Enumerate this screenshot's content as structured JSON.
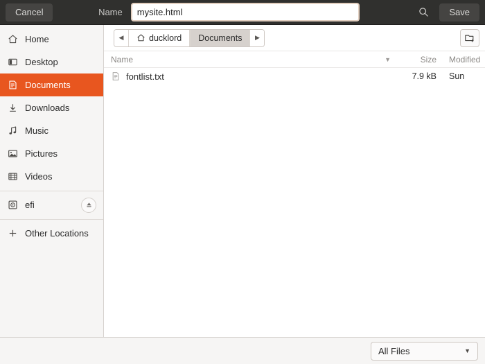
{
  "header": {
    "cancel_label": "Cancel",
    "name_label": "Name",
    "filename_value": "mysite.html",
    "filename_placeholder": "Name",
    "save_label": "Save",
    "search_icon": "search-icon"
  },
  "sidebar": {
    "items": [
      {
        "label": "Home",
        "icon": "home-icon",
        "selected": false,
        "separator_before": false,
        "eject": false
      },
      {
        "label": "Desktop",
        "icon": "desktop-icon",
        "selected": false,
        "separator_before": false,
        "eject": false
      },
      {
        "label": "Documents",
        "icon": "document-icon",
        "selected": true,
        "separator_before": false,
        "eject": false
      },
      {
        "label": "Downloads",
        "icon": "download-icon",
        "selected": false,
        "separator_before": false,
        "eject": false
      },
      {
        "label": "Music",
        "icon": "music-icon",
        "selected": false,
        "separator_before": false,
        "eject": false
      },
      {
        "label": "Pictures",
        "icon": "picture-icon",
        "selected": false,
        "separator_before": false,
        "eject": false
      },
      {
        "label": "Videos",
        "icon": "video-icon",
        "selected": false,
        "separator_before": false,
        "eject": false
      },
      {
        "label": "efi",
        "icon": "disk-icon",
        "selected": false,
        "separator_before": true,
        "eject": true
      },
      {
        "label": "Other Locations",
        "icon": "plus-icon",
        "selected": false,
        "separator_before": true,
        "eject": false
      }
    ]
  },
  "pathbar": {
    "back_glyph": "◀",
    "forward_glyph": "▶",
    "crumbs": [
      {
        "label": "ducklord",
        "icon": "home-icon",
        "active": false
      },
      {
        "label": "Documents",
        "icon": "",
        "active": true
      }
    ],
    "new_folder_icon": "new-folder-icon"
  },
  "columns": {
    "name": "Name",
    "size": "Size",
    "modified": "Modified",
    "sort_glyph": "▼"
  },
  "files": [
    {
      "name": "fontlist.txt",
      "size": "7.9 kB",
      "modified": "Sun",
      "icon": "text-file-icon"
    }
  ],
  "footer": {
    "filter_value": "All Files",
    "filter_chevron": "▼"
  },
  "colors": {
    "accent": "#e8561f",
    "headerbar": "#30302e",
    "sidebar": "#f6f5f4",
    "focus_border": "#e2cfc0"
  }
}
